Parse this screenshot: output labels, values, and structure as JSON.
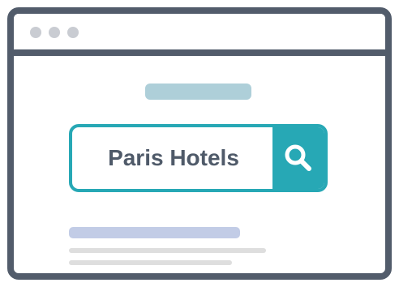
{
  "search": {
    "query": "Paris Hotels"
  },
  "icons": {
    "search_button": "search-icon",
    "window_controls": [
      "window-dot",
      "window-dot",
      "window-dot"
    ]
  },
  "colors": {
    "accent": "#27a8b5",
    "frame": "#525c6b",
    "text": "#4f5a69",
    "placeholder_header": "#aecfd9",
    "placeholder_result_title": "#c2cce6",
    "placeholder_result_lines": "#dedede"
  }
}
